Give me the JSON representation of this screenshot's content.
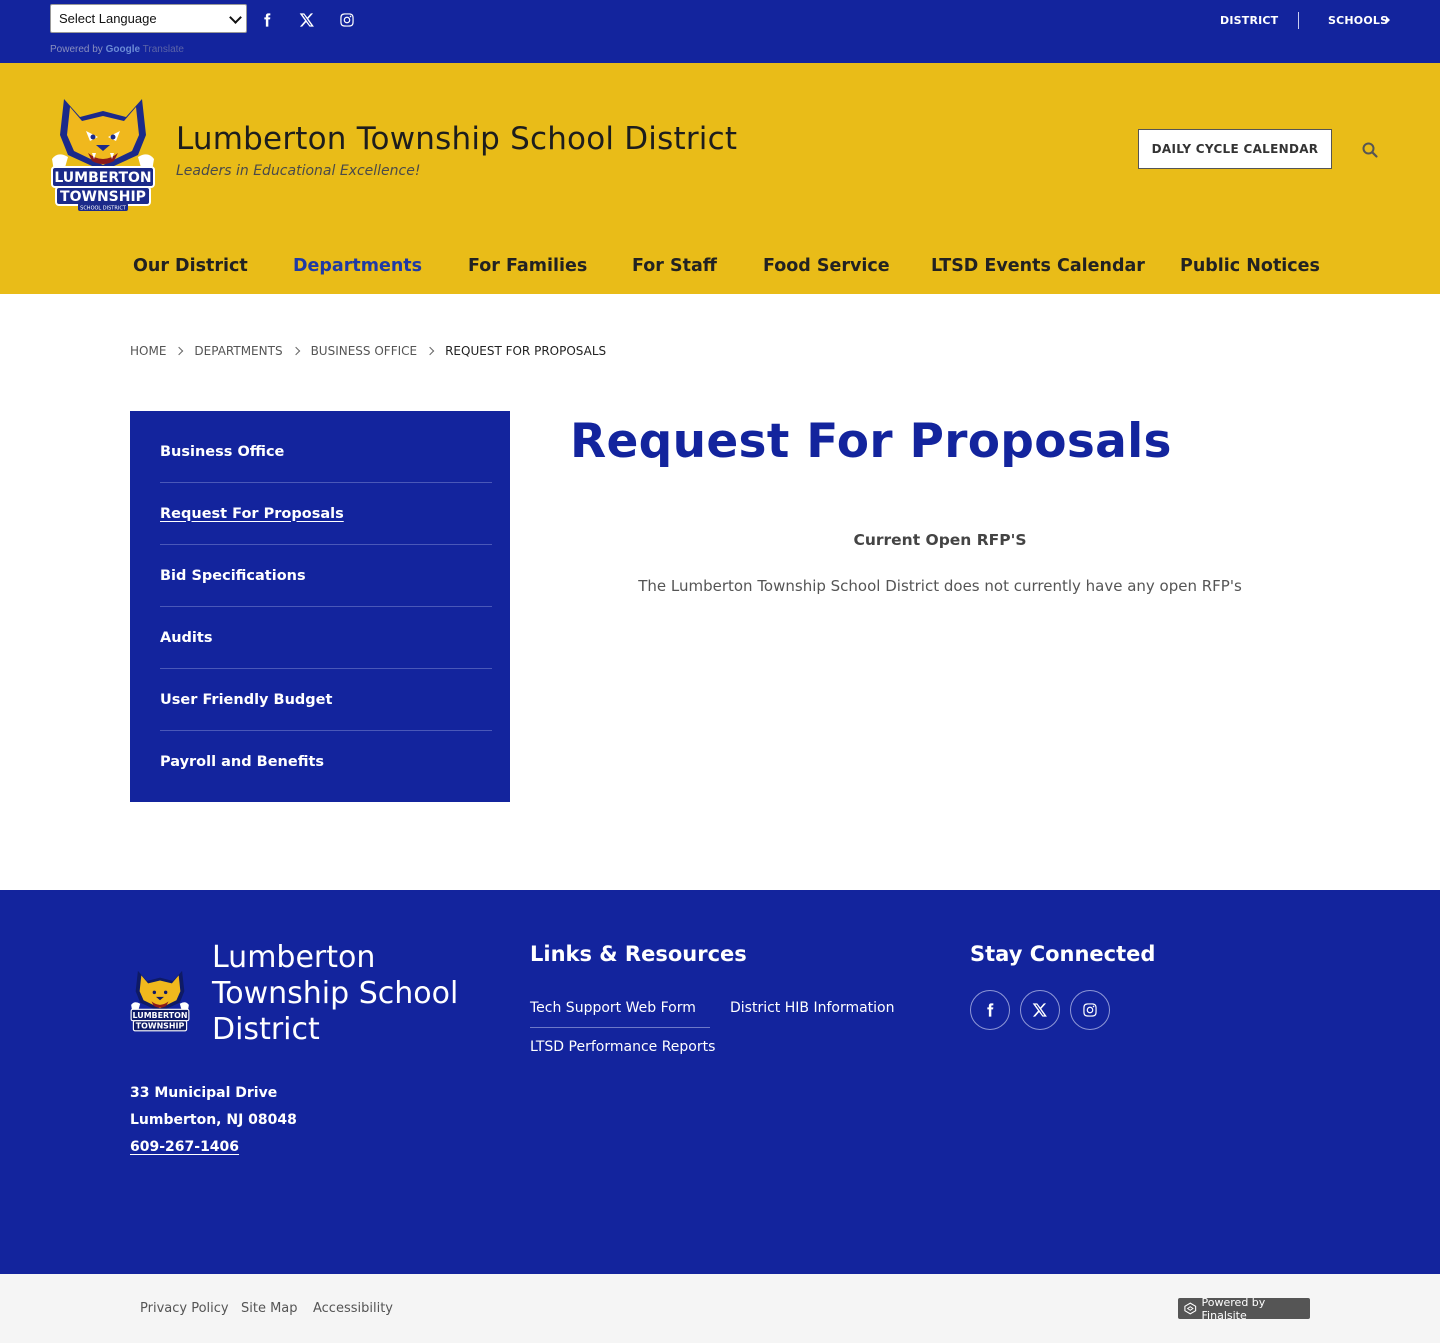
{
  "topbar": {
    "language_select": "Select Language",
    "powered_by": "Powered by",
    "google": "Google",
    "translate": "Translate",
    "links": {
      "district": "DISTRICT",
      "schools": "SCHOOLS"
    }
  },
  "header": {
    "title": "Lumberton Township School District",
    "tagline": "Leaders in Educational Excellence!",
    "daily_cycle_button": "DAILY CYCLE CALENDAR",
    "logo_text": "LUMBERTON TOWNSHIP SCHOOL DISTRICT"
  },
  "nav": {
    "items": [
      {
        "label": "Our District"
      },
      {
        "label": "Departments",
        "active": true
      },
      {
        "label": "For Families"
      },
      {
        "label": "For Staff"
      },
      {
        "label": "Food Service"
      },
      {
        "label": "LTSD Events Calendar"
      },
      {
        "label": "Public Notices"
      }
    ]
  },
  "breadcrumb": [
    "HOME",
    "DEPARTMENTS",
    "BUSINESS OFFICE",
    "REQUEST FOR PROPOSALS"
  ],
  "sidebar": {
    "items": [
      {
        "label": "Business Office"
      },
      {
        "label": "Request For Proposals",
        "current": true
      },
      {
        "label": "Bid Specifications"
      },
      {
        "label": "Audits"
      },
      {
        "label": "User Friendly Budget"
      },
      {
        "label": "Payroll and Benefits"
      }
    ]
  },
  "main": {
    "title": "Request For Proposals",
    "heading": "Current Open RFP'S",
    "text": "The Lumberton Township School District does not currently have any open RFP's"
  },
  "footer": {
    "name": "Lumberton Township School District",
    "address_line1": "33 Municipal Drive",
    "address_line2": "Lumberton, NJ  08048",
    "phone": "609-267-1406",
    "links_heading": "Links & Resources",
    "links": [
      "Tech Support Web Form",
      "District HIB Information",
      "LTSD Performance Reports"
    ],
    "connect_heading": "Stay Connected",
    "social": [
      "facebook-icon",
      "x-twitter-icon",
      "instagram-icon"
    ]
  },
  "bottom": {
    "links": [
      "Privacy Policy",
      "Site Map",
      "Accessibility"
    ],
    "powered": "Powered by Finalsite"
  },
  "colors": {
    "primary_blue": "#13249d",
    "gold": "#e9bc18",
    "nav_active": "#1f3aa6"
  }
}
